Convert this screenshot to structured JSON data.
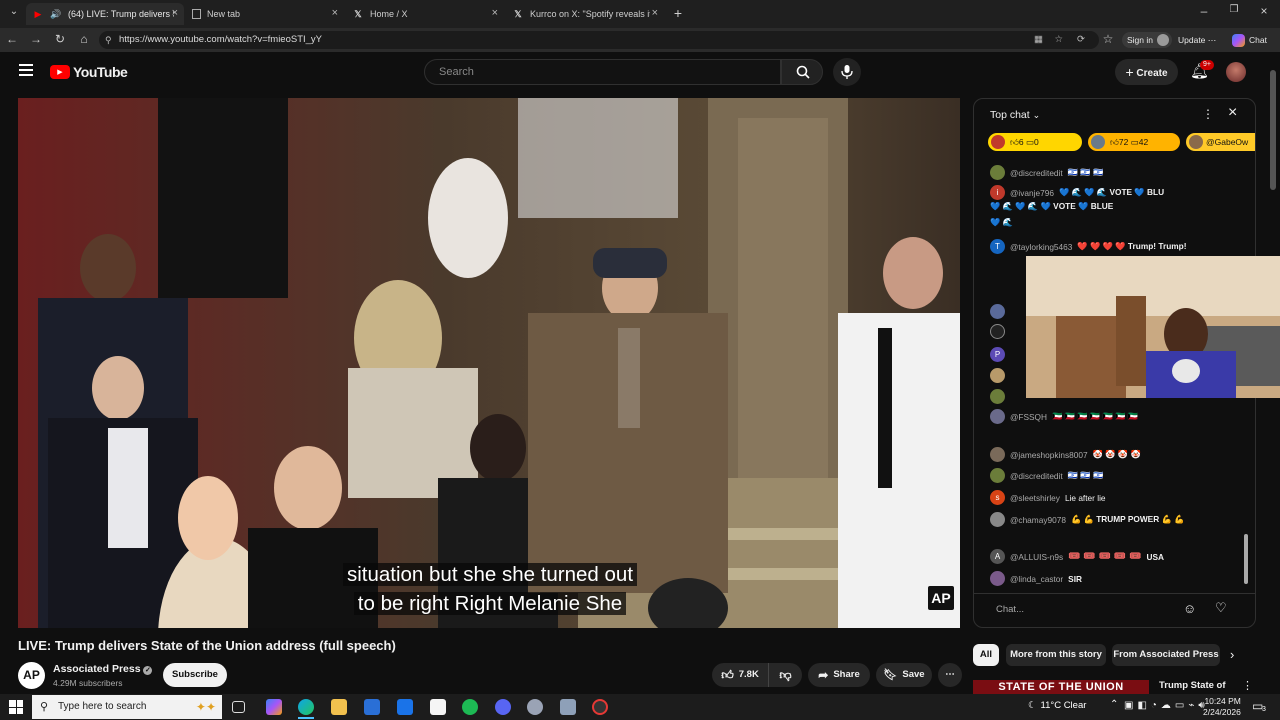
{
  "browser": {
    "tabs": [
      {
        "title": "(64) LIVE: Trump delivers State"
      },
      {
        "title": "New tab"
      },
      {
        "title": "Home / X"
      },
      {
        "title": "Kurrco on X: \"Spotify reveals its li"
      }
    ],
    "url": "https://www.youtube.com/watch?v=fmieoSTI_yY",
    "sign_in": "Sign in",
    "update": "Update",
    "chat": "Chat"
  },
  "youtube": {
    "logo": "YouTube",
    "search_placeholder": "Search",
    "create": "Create",
    "notif_badge": "9+"
  },
  "video": {
    "caption_line1": "situation but she she turned out",
    "caption_line2": "to be right Right Melanie She",
    "watermark": "AP",
    "title": "LIVE: Trump delivers State of the Union address (full speech)",
    "channel": "Associated Press",
    "channel_logo": "AP",
    "subscribers": "4.29M subscribers",
    "subscribe": "Subscribe",
    "likes": "7.8K",
    "share": "Share",
    "save": "Save"
  },
  "chat": {
    "header": "Top chat",
    "pinned": [
      {
        "a": "6",
        "b": "0"
      },
      {
        "a": "72",
        "b": "42"
      },
      {
        "name": "@GabeOw"
      }
    ],
    "messages": [
      {
        "user": "@discreditedit",
        "text": "🇮🇱 🇮🇱 🇮🇱",
        "color": "#6b7d3a",
        "initial": ""
      },
      {
        "user": "@ivanje796",
        "text": "💙 🌊 💙 🌊 VOTE 💙 BLU",
        "color": "#c0392b",
        "initial": "i"
      },
      {
        "user": "",
        "text": "💙 🌊 💙 🌊 💙 VOTE 💙 BLUE",
        "color": "",
        "initial": ""
      },
      {
        "user": "",
        "text": "💙 🌊",
        "color": "",
        "initial": ""
      },
      {
        "user": "@taylorking5463",
        "text": "❤️ ❤️ ❤️ ❤️ Trump! Trump!",
        "color": "#1565c0",
        "initial": "T"
      },
      {
        "user": "@FSSQH",
        "text": "🇰🇼 🇰🇼 🇰🇼 🇰🇼 🇰🇼 🇰🇼 🇰🇼",
        "color": "#6a6a8a",
        "initial": ""
      },
      {
        "user": "@jameshopkins8007",
        "text": "🤡 🤡 🤡 🤡",
        "color": "#7a6a5a",
        "initial": ""
      },
      {
        "user": "@discreditedit",
        "text": "🇮🇱 🇮🇱 🇮🇱",
        "color": "#6b7d3a",
        "initial": ""
      },
      {
        "user": "@sleetshirley",
        "text": "Lie after lie",
        "color": "#d84315",
        "initial": "s"
      },
      {
        "user": "@chamay9078",
        "text": "💪 💪 TRUMP POWER 💪 💪",
        "color": "#888",
        "initial": ""
      },
      {
        "user": "@ALLUIS-n9s",
        "text": "USA",
        "color": "#555",
        "initial": "A"
      },
      {
        "user": "@linda_castor",
        "text": "SIR",
        "color": "#7a5a8a",
        "initial": ""
      }
    ],
    "input_placeholder": "Chat...",
    "filters": [
      "All",
      "More from this story",
      "From Associated Press"
    ],
    "rec_title": "Trump State of",
    "rec_banner": "STATE OF THE UNION"
  },
  "taskbar": {
    "search_placeholder": "Type here to search",
    "weather": "11°C  Clear",
    "time": "10:24 PM",
    "date": "2/24/2026",
    "notif_count": "3"
  }
}
